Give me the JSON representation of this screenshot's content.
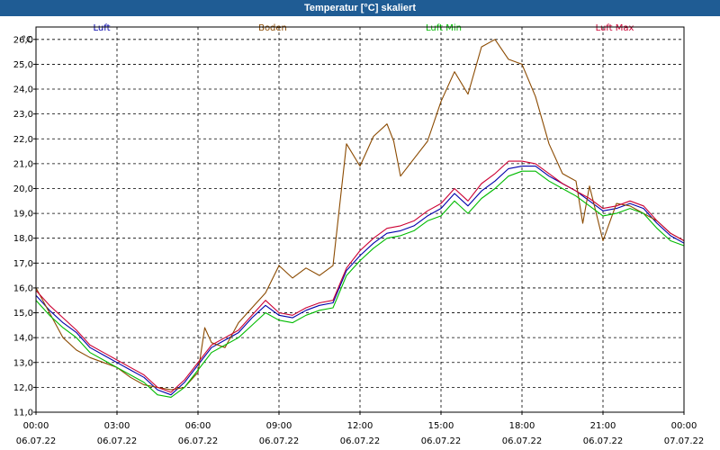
{
  "chart_data": {
    "type": "line",
    "title": "Temperatur [°C] skaliert",
    "ylabel": "°C",
    "ylim": [
      11.0,
      26.5
    ],
    "y_ticks": [
      "11,0",
      "12,0",
      "13,0",
      "14,0",
      "15,0",
      "16,0",
      "17,0",
      "18,0",
      "19,0",
      "20,0",
      "21,0",
      "22,0",
      "23,0",
      "24,0",
      "25,0",
      "26,0"
    ],
    "x_range_hours": [
      0,
      24
    ],
    "x_ticks": [
      {
        "time": "00:00",
        "date": "06.07.22"
      },
      {
        "time": "03:00",
        "date": "06.07.22"
      },
      {
        "time": "06:00",
        "date": "06.07.22"
      },
      {
        "time": "09:00",
        "date": "06.07.22"
      },
      {
        "time": "12:00",
        "date": "06.07.22"
      },
      {
        "time": "15:00",
        "date": "06.07.22"
      },
      {
        "time": "18:00",
        "date": "06.07.22"
      },
      {
        "time": "21:00",
        "date": "06.07.22"
      },
      {
        "time": "00:00",
        "date": "07.07.22"
      }
    ],
    "grid": true,
    "legend_position": "top",
    "series": [
      {
        "name": "Luft",
        "color": "#0000aa",
        "points": [
          [
            0,
            15.7
          ],
          [
            0.5,
            15.1
          ],
          [
            1,
            14.6
          ],
          [
            1.5,
            14.2
          ],
          [
            2,
            13.6
          ],
          [
            2.5,
            13.3
          ],
          [
            3,
            13.0
          ],
          [
            3.5,
            12.7
          ],
          [
            4,
            12.4
          ],
          [
            4.5,
            11.9
          ],
          [
            5,
            11.7
          ],
          [
            5.5,
            12.2
          ],
          [
            6,
            12.9
          ],
          [
            6.5,
            13.6
          ],
          [
            7,
            13.9
          ],
          [
            7.5,
            14.2
          ],
          [
            8,
            14.8
          ],
          [
            8.5,
            15.3
          ],
          [
            9,
            14.9
          ],
          [
            9.5,
            14.8
          ],
          [
            10,
            15.1
          ],
          [
            10.5,
            15.3
          ],
          [
            11,
            15.4
          ],
          [
            11.5,
            16.7
          ],
          [
            12,
            17.3
          ],
          [
            12.5,
            17.8
          ],
          [
            13,
            18.2
          ],
          [
            13.5,
            18.3
          ],
          [
            14,
            18.5
          ],
          [
            14.5,
            18.9
          ],
          [
            15,
            19.2
          ],
          [
            15.5,
            19.8
          ],
          [
            16,
            19.3
          ],
          [
            16.5,
            19.9
          ],
          [
            17,
            20.3
          ],
          [
            17.5,
            20.8
          ],
          [
            18,
            20.9
          ],
          [
            18.5,
            20.9
          ],
          [
            19,
            20.5
          ],
          [
            19.5,
            20.2
          ],
          [
            20,
            19.9
          ],
          [
            20.5,
            19.5
          ],
          [
            21,
            19.1
          ],
          [
            21.5,
            19.2
          ],
          [
            22,
            19.4
          ],
          [
            22.5,
            19.2
          ],
          [
            23,
            18.6
          ],
          [
            23.5,
            18.1
          ],
          [
            24,
            17.8
          ]
        ]
      },
      {
        "name": "Boden",
        "color": "#8b4a00",
        "points": [
          [
            0,
            16.0
          ],
          [
            0.5,
            15.0
          ],
          [
            1,
            14.0
          ],
          [
            1.5,
            13.5
          ],
          [
            2,
            13.2
          ],
          [
            2.5,
            13.0
          ],
          [
            3,
            12.8
          ],
          [
            3.5,
            12.4
          ],
          [
            4,
            12.1
          ],
          [
            4.5,
            12.0
          ],
          [
            5,
            11.9
          ],
          [
            5.5,
            12.0
          ],
          [
            6,
            12.6
          ],
          [
            6.25,
            14.4
          ],
          [
            6.5,
            13.8
          ],
          [
            7,
            13.6
          ],
          [
            7.5,
            14.6
          ],
          [
            8,
            15.2
          ],
          [
            8.5,
            15.8
          ],
          [
            9,
            16.9
          ],
          [
            9.5,
            16.4
          ],
          [
            10,
            16.8
          ],
          [
            10.5,
            16.5
          ],
          [
            11,
            16.9
          ],
          [
            11.5,
            21.8
          ],
          [
            12,
            20.9
          ],
          [
            12.5,
            22.1
          ],
          [
            13,
            22.6
          ],
          [
            13.25,
            21.9
          ],
          [
            13.5,
            20.5
          ],
          [
            14,
            21.2
          ],
          [
            14.5,
            21.9
          ],
          [
            15,
            23.5
          ],
          [
            15.5,
            24.7
          ],
          [
            16,
            23.8
          ],
          [
            16.5,
            25.7
          ],
          [
            17,
            26.0
          ],
          [
            17.5,
            25.2
          ],
          [
            18,
            25.0
          ],
          [
            18.5,
            23.7
          ],
          [
            19,
            21.8
          ],
          [
            19.5,
            20.6
          ],
          [
            20,
            20.3
          ],
          [
            20.25,
            18.6
          ],
          [
            20.5,
            20.1
          ],
          [
            21,
            17.9
          ],
          [
            21.5,
            19.4
          ],
          [
            22,
            19.3
          ],
          [
            22.5,
            19.0
          ],
          [
            23,
            18.7
          ],
          [
            23.5,
            18.2
          ],
          [
            24,
            17.9
          ]
        ]
      },
      {
        "name": "Luft Min",
        "color": "#00bb00",
        "points": [
          [
            0,
            15.5
          ],
          [
            0.5,
            14.9
          ],
          [
            1,
            14.4
          ],
          [
            1.5,
            14.0
          ],
          [
            2,
            13.4
          ],
          [
            2.5,
            13.1
          ],
          [
            3,
            12.8
          ],
          [
            3.5,
            12.5
          ],
          [
            4,
            12.2
          ],
          [
            4.5,
            11.7
          ],
          [
            5,
            11.6
          ],
          [
            5.5,
            12.0
          ],
          [
            6,
            12.7
          ],
          [
            6.5,
            13.4
          ],
          [
            7,
            13.7
          ],
          [
            7.5,
            14.0
          ],
          [
            8,
            14.5
          ],
          [
            8.5,
            15.0
          ],
          [
            9,
            14.7
          ],
          [
            9.5,
            14.6
          ],
          [
            10,
            14.9
          ],
          [
            10.5,
            15.1
          ],
          [
            11,
            15.2
          ],
          [
            11.5,
            16.5
          ],
          [
            12,
            17.1
          ],
          [
            12.5,
            17.6
          ],
          [
            13,
            18.0
          ],
          [
            13.5,
            18.1
          ],
          [
            14,
            18.3
          ],
          [
            14.5,
            18.7
          ],
          [
            15,
            18.9
          ],
          [
            15.5,
            19.5
          ],
          [
            16,
            19.0
          ],
          [
            16.5,
            19.6
          ],
          [
            17,
            20.0
          ],
          [
            17.5,
            20.5
          ],
          [
            18,
            20.7
          ],
          [
            18.5,
            20.7
          ],
          [
            19,
            20.3
          ],
          [
            19.5,
            20.0
          ],
          [
            20,
            19.7
          ],
          [
            20.5,
            19.3
          ],
          [
            21,
            18.9
          ],
          [
            21.5,
            19.0
          ],
          [
            22,
            19.2
          ],
          [
            22.5,
            19.0
          ],
          [
            23,
            18.4
          ],
          [
            23.5,
            17.9
          ],
          [
            24,
            17.7
          ]
        ]
      },
      {
        "name": "Luft Max",
        "color": "#cc0033",
        "points": [
          [
            0,
            15.9
          ],
          [
            0.5,
            15.3
          ],
          [
            1,
            14.8
          ],
          [
            1.5,
            14.3
          ],
          [
            2,
            13.7
          ],
          [
            2.5,
            13.4
          ],
          [
            3,
            13.1
          ],
          [
            3.5,
            12.8
          ],
          [
            4,
            12.5
          ],
          [
            4.5,
            12.0
          ],
          [
            5,
            11.8
          ],
          [
            5.5,
            12.3
          ],
          [
            6,
            13.0
          ],
          [
            6.5,
            13.7
          ],
          [
            7,
            14.0
          ],
          [
            7.5,
            14.3
          ],
          [
            8,
            14.9
          ],
          [
            8.5,
            15.5
          ],
          [
            9,
            15.0
          ],
          [
            9.5,
            14.9
          ],
          [
            10,
            15.2
          ],
          [
            10.5,
            15.4
          ],
          [
            11,
            15.5
          ],
          [
            11.5,
            16.8
          ],
          [
            12,
            17.5
          ],
          [
            12.5,
            18.0
          ],
          [
            13,
            18.4
          ],
          [
            13.5,
            18.5
          ],
          [
            14,
            18.7
          ],
          [
            14.5,
            19.1
          ],
          [
            15,
            19.4
          ],
          [
            15.5,
            20.0
          ],
          [
            16,
            19.5
          ],
          [
            16.5,
            20.2
          ],
          [
            17,
            20.6
          ],
          [
            17.5,
            21.1
          ],
          [
            18,
            21.1
          ],
          [
            18.5,
            21.0
          ],
          [
            19,
            20.6
          ],
          [
            19.5,
            20.2
          ],
          [
            20,
            19.9
          ],
          [
            20.5,
            19.6
          ],
          [
            21,
            19.2
          ],
          [
            21.5,
            19.3
          ],
          [
            22,
            19.5
          ],
          [
            22.5,
            19.3
          ],
          [
            23,
            18.7
          ],
          [
            23.5,
            18.2
          ],
          [
            24,
            17.9
          ]
        ]
      }
    ]
  }
}
